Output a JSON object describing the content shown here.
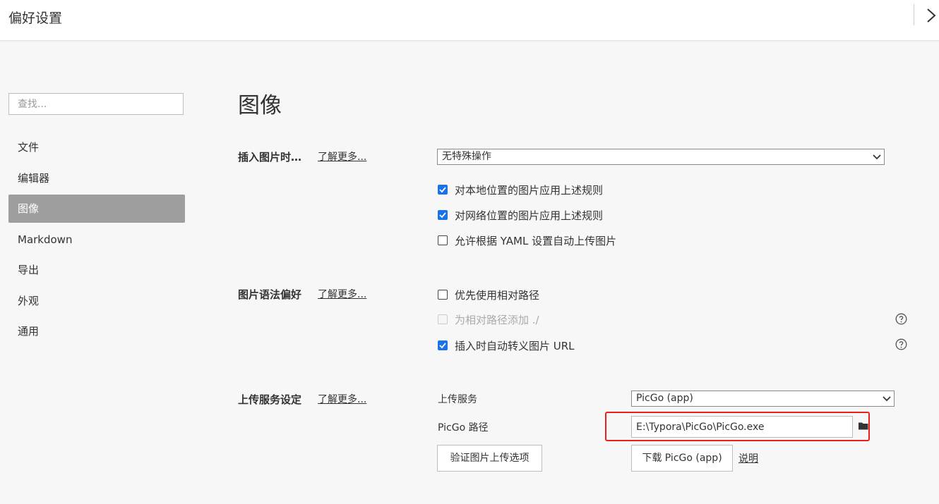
{
  "window": {
    "title": "偏好设置"
  },
  "sidebar": {
    "search_placeholder": "查找...",
    "items": [
      {
        "label": "文件",
        "active": false
      },
      {
        "label": "编辑器",
        "active": false
      },
      {
        "label": "图像",
        "active": true
      },
      {
        "label": "Markdown",
        "active": false
      },
      {
        "label": "导出",
        "active": false
      },
      {
        "label": "外观",
        "active": false
      },
      {
        "label": "通用",
        "active": false
      }
    ]
  },
  "main": {
    "page_title": "图像",
    "insert_section": {
      "label": "插入图片时…",
      "learn_more": "了解更多...",
      "action_select": "无特殊操作",
      "options": [
        {
          "label": "对本地位置的图片应用上述规则",
          "checked": true
        },
        {
          "label": "对网络位置的图片应用上述规则",
          "checked": true
        },
        {
          "label": "允许根据 YAML 设置自动上传图片",
          "checked": false
        }
      ]
    },
    "syntax_section": {
      "label": "图片语法偏好",
      "learn_more": "了解更多...",
      "options": [
        {
          "label": "优先使用相对路径",
          "checked": false,
          "disabled": false
        },
        {
          "label": "为相对路径添加 ./",
          "checked": false,
          "disabled": true
        },
        {
          "label": "插入时自动转义图片 URL",
          "checked": true,
          "disabled": false
        }
      ]
    },
    "upload_section": {
      "label": "上传服务设定",
      "learn_more": "了解更多...",
      "service_label": "上传服务",
      "service_value": "PicGo (app)",
      "path_label": "PicGo 路径",
      "path_value": "E:\\Typora\\PicGo\\PicGo.exe",
      "verify_button": "验证图片上传选项",
      "download_button": "下载 PicGo (app)",
      "docs_link": "说明"
    }
  },
  "colors": {
    "accent": "#1a73e8",
    "active_nav_bg": "#9e9e9e",
    "highlight": "#e8211b",
    "background": "#f7f7f7"
  },
  "icons": {
    "close": "chevron-right-icon",
    "select": "chevron-down-icon",
    "help": "question-circle-icon",
    "folder": "folder-icon"
  }
}
